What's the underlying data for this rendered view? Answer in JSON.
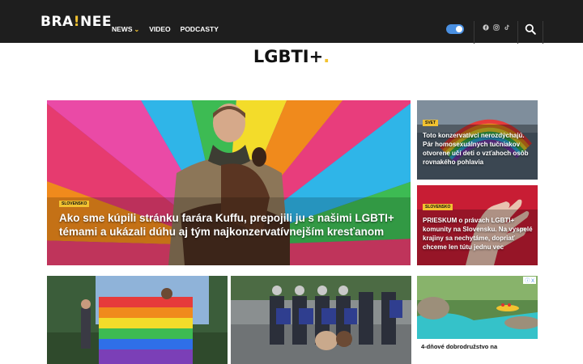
{
  "header": {
    "logo_left": "BRA",
    "logo_mark": "!",
    "logo_right": "NEE",
    "nav": [
      {
        "label": "NEWS",
        "has_dropdown": true
      },
      {
        "label": "VIDEO",
        "has_dropdown": false
      },
      {
        "label": "PODCASTY",
        "has_dropdown": false
      }
    ],
    "social_icons": [
      "facebook-icon",
      "instagram-icon",
      "tiktok-icon"
    ],
    "search_icon": "search-icon"
  },
  "page": {
    "title": "LGBTI+",
    "title_dot": "."
  },
  "articles": {
    "hero": {
      "category": "SLOVENSKO",
      "headline": "Ako sme kúpili stránku farára Kuffu, prepojili ju s našimi LGBTI+ témami a ukázali dúhu aj tým najkonzervatívnejším kresťanom"
    },
    "side": [
      {
        "category": "SVET",
        "headline": "Toto konzervatívci nerozdýchajú. Pár homosexuálnych tučniakov otvorene učí deti o vzťahoch osôb rovnakého pohlavia"
      },
      {
        "category": "SLOVENSKO",
        "headline": "PRIESKUM o právach LGBTI+ komunity na Slovensku. Na vyspelé krajiny sa nechytáme, dopriať chceme len tútu jednu vec"
      }
    ],
    "ad": {
      "chip": "ⓘ X",
      "caption": "4-dňové dobrodružstvo na"
    }
  },
  "colors": {
    "header_bg": "#1e1e1e",
    "accent": "#f2c230",
    "toggle": "#4a90e2"
  }
}
